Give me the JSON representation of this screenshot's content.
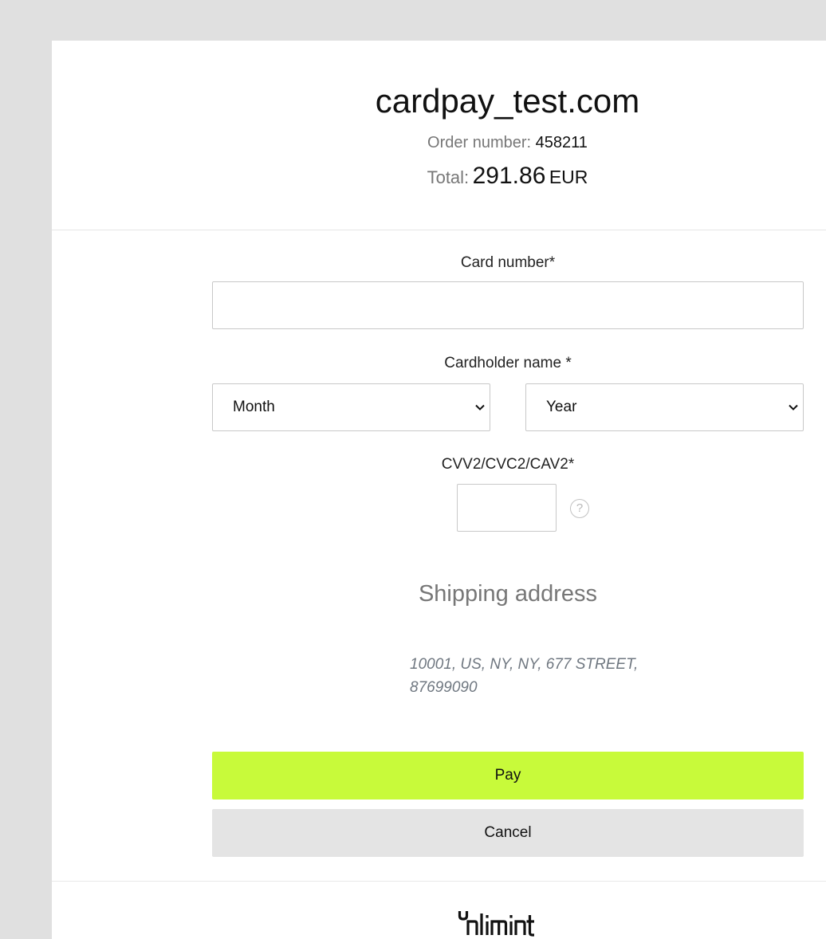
{
  "merchant": {
    "name": "cardpay_test.com"
  },
  "order": {
    "number_label": "Order number:",
    "number_value": "458211",
    "total_label": "Total:",
    "total_amount": "291.86",
    "total_currency": "EUR"
  },
  "form": {
    "card_number_label": "Card number*",
    "card_number_value": "",
    "cardholder_label": "Cardholder name *",
    "month_select": "Month",
    "year_select": "Year",
    "cvv_label": "CVV2/CVC2/CAV2*",
    "cvv_value": "",
    "help_glyph": "?"
  },
  "shipping": {
    "title": "Shipping address",
    "address": "10001, US, NY, NY, 677 STREET, 87699090"
  },
  "actions": {
    "pay_label": "Pay",
    "cancel_label": "Cancel"
  },
  "footer": {
    "logo_text": "Unlimint"
  },
  "colors": {
    "background": "#e0e0e0",
    "panel": "#ffffff",
    "pay_button": "#c8fa3a",
    "cancel_button": "#e4e4e4",
    "muted_text": "#777777"
  },
  "icons": {
    "select_chevron": "chevron-down-icon",
    "help": "question-circle-icon"
  }
}
